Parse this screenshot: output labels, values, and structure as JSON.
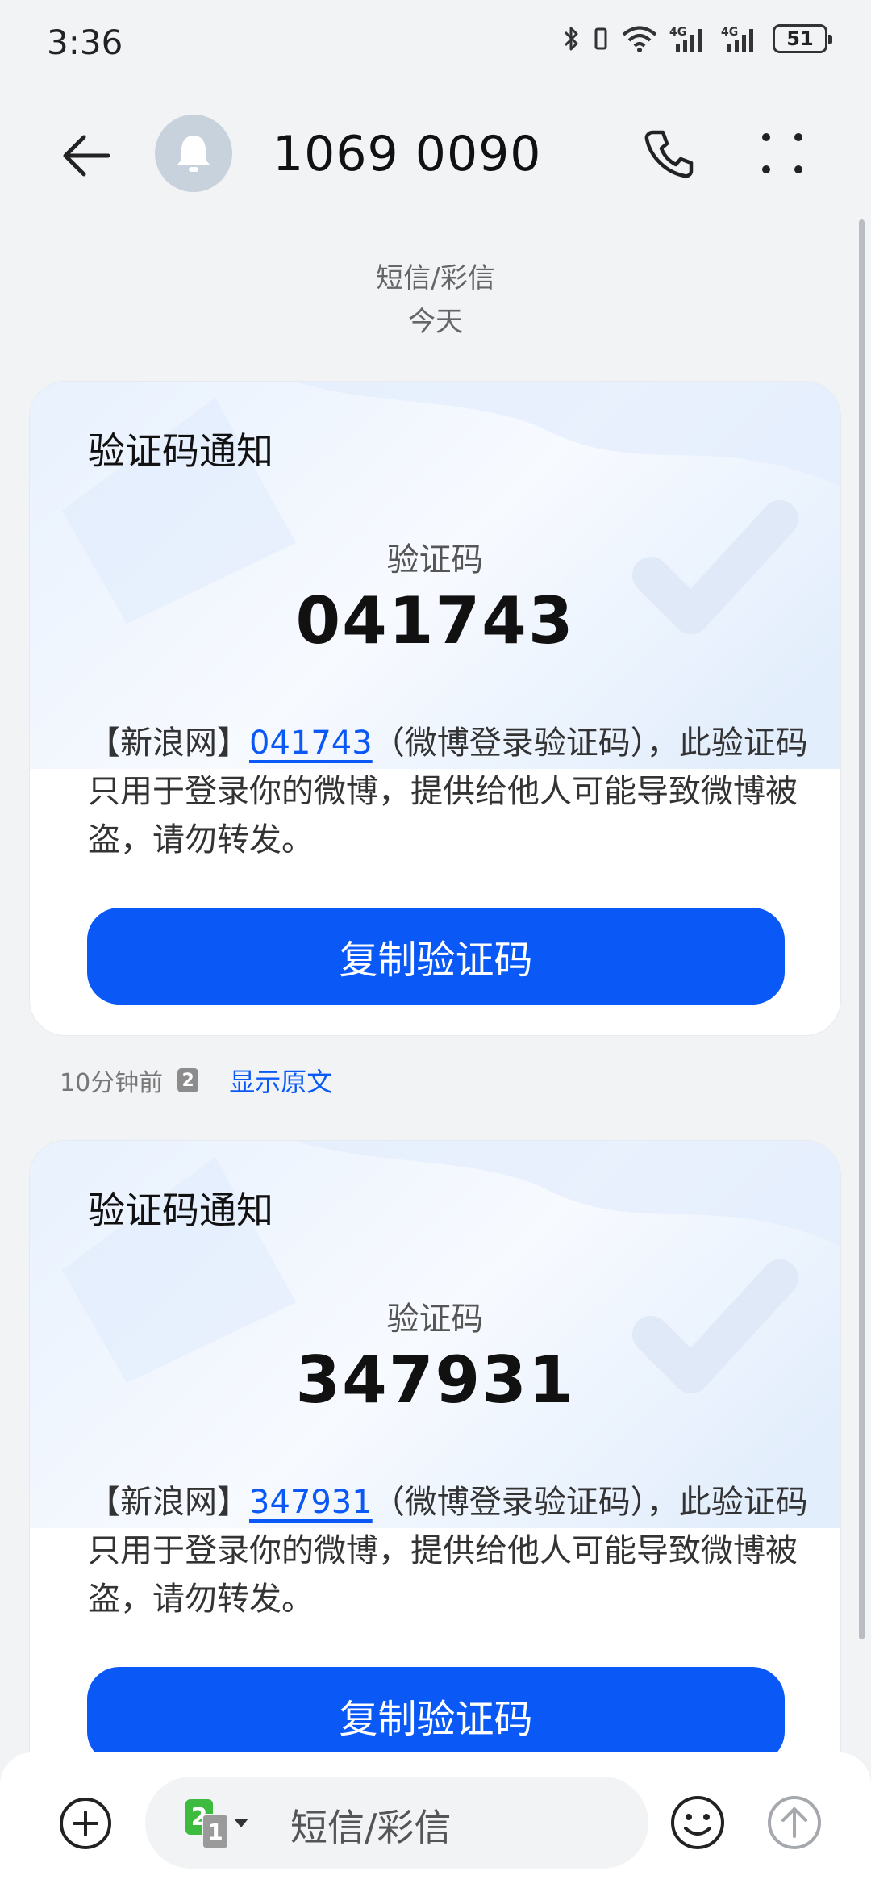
{
  "status_bar": {
    "time": "3:36",
    "network_1": "4G",
    "network_2": "4G",
    "battery_level": "51"
  },
  "header": {
    "title": "1069 0090",
    "avatar_icon": "bell-icon"
  },
  "date_header": {
    "channel": "短信/彩信",
    "day": "今天"
  },
  "messages": [
    {
      "title": "验证码通知",
      "code_label": "验证码",
      "code": "041743",
      "body_prefix": "【新浪网】",
      "body_code": "041743",
      "body_suffix": "（微博登录验证码），此验证码只用于登录你的微博，提供给他人可能导致微博被盗，请勿转发。",
      "copy_label": "复制验证码"
    },
    {
      "title": "验证码通知",
      "code_label": "验证码",
      "code": "347931",
      "body_prefix": "【新浪网】",
      "body_code": "347931",
      "body_suffix": "（微博登录验证码），此验证码只用于登录你的微博，提供给他人可能导致微博被盗，请勿转发。",
      "copy_label": "复制验证码"
    }
  ],
  "message_meta": {
    "time_ago": "10分钟前",
    "sim": "2",
    "show_original": "显示原文"
  },
  "input_bar": {
    "placeholder": "短信/彩信",
    "sim_primary": "2",
    "sim_secondary": "1"
  },
  "colors": {
    "accent": "#0a59f7",
    "background": "#f1f3f5",
    "card": "#ffffff",
    "sim_green": "#3dbb3f"
  }
}
